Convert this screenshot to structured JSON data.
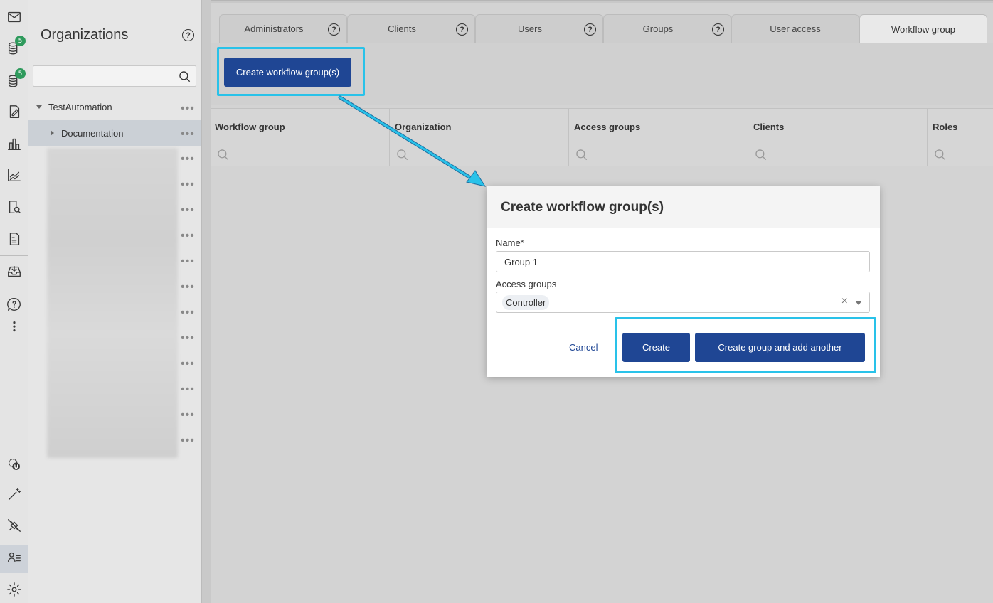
{
  "rail": {
    "badge_count_1": "5",
    "badge_count_2": "5"
  },
  "organizations": {
    "title": "Organizations",
    "help": "?",
    "search_placeholder": "",
    "tree": [
      {
        "label": "TestAutomation",
        "expanded": true
      },
      {
        "label": "Documentation",
        "expanded": false,
        "selected": true
      }
    ],
    "more": "•••"
  },
  "tabs": [
    {
      "label": "Administrators",
      "help": "?"
    },
    {
      "label": "Clients",
      "help": "?"
    },
    {
      "label": "Users",
      "help": "?"
    },
    {
      "label": "Groups",
      "help": "?"
    },
    {
      "label": "User access"
    },
    {
      "label": "Workflow group",
      "active": true
    }
  ],
  "toolbar": {
    "create_label": "Create workflow group(s)"
  },
  "grid": {
    "columns": [
      "Workflow group",
      "Organization",
      "Access groups",
      "Clients",
      "Roles"
    ]
  },
  "modal": {
    "title": "Create workflow group(s)",
    "name_label": "Name*",
    "name_value": "Group 1",
    "access_label": "Access groups",
    "access_selected": "Controller",
    "clear": "×",
    "cancel_label": "Cancel",
    "create_label": "Create",
    "create_another_label": "Create group and add another"
  },
  "colors": {
    "accent": "#1f4694",
    "highlight": "#29c2e9",
    "badge": "#2e9a5c"
  }
}
